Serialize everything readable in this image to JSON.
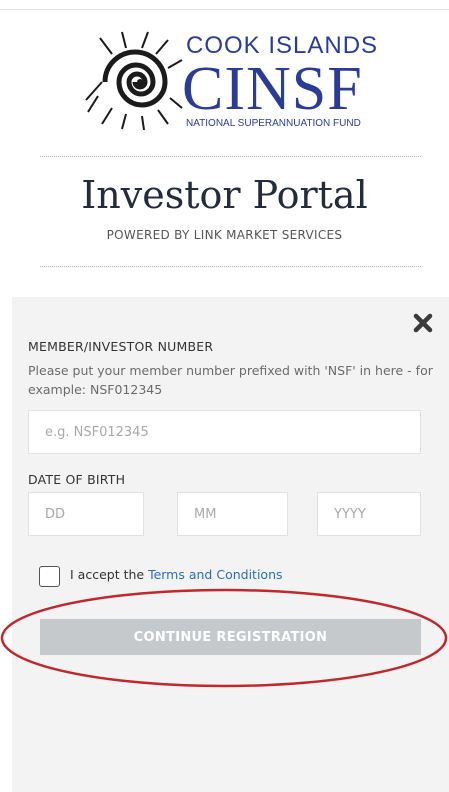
{
  "logo": {
    "line1": "COOK ISLANDS",
    "line2": "CINSF",
    "line3": "NATIONAL SUPERANNUATION FUND"
  },
  "header": {
    "title": "Investor Portal",
    "subtitle": "POWERED BY LINK MARKET SERVICES"
  },
  "form": {
    "member_label": "MEMBER/INVESTOR NUMBER",
    "member_help": "Please put your member number prefixed with 'NSF' in here - for example: NSF012345",
    "member_placeholder": "e.g. NSF012345",
    "dob_label": "DATE OF BIRTH",
    "dd_placeholder": "DD",
    "mm_placeholder": "MM",
    "yyyy_placeholder": "YYYY",
    "accept_prefix": "I accept the ",
    "terms_link": "Terms and Conditions",
    "continue_label": "CONTINUE REGISTRATION"
  },
  "colors": {
    "brand": "#2b3c97",
    "link": "#2c6fb7",
    "button_disabled": "#c5c9cc",
    "annotation": "#c0282d"
  }
}
